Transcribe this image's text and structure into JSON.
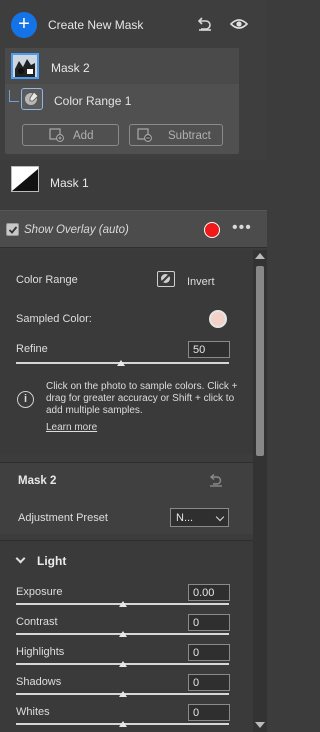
{
  "masks": {
    "create_label": "Create New Mask",
    "plus_icon": "plus-icon",
    "items": [
      {
        "label": "Mask 2",
        "selected": true
      },
      {
        "label": "Color Range 1",
        "child_of": "Mask 2"
      },
      {
        "label": "Mask 1"
      }
    ],
    "add_label": "Add",
    "subtract_label": "Subtract",
    "show_overlay_label": "Show Overlay (auto)",
    "show_overlay_checked": true,
    "overlay_color": "#f01818"
  },
  "color_range": {
    "title": "Color Range",
    "invert_label": "Invert",
    "sampled_color_label": "Sampled Color:",
    "sampled_color": "#f2d2c8",
    "refine_label": "Refine",
    "refine_value": "50",
    "refine_fraction": 0.5,
    "info_text": "Click on the photo to sample colors. Click + drag for greater accuracy or Shift + click to add multiple samples.",
    "learn_more": "Learn more"
  },
  "mask_panel": {
    "title": "Mask 2",
    "preset_label": "Adjustment Preset",
    "preset_value": "N..."
  },
  "light": {
    "title": "Light",
    "sliders": [
      {
        "label": "Exposure",
        "value": "0.00",
        "fraction": 0.5
      },
      {
        "label": "Contrast",
        "value": "0",
        "fraction": 0.5
      },
      {
        "label": "Highlights",
        "value": "0",
        "fraction": 0.5
      },
      {
        "label": "Shadows",
        "value": "0",
        "fraction": 0.5
      },
      {
        "label": "Whites",
        "value": "0",
        "fraction": 0.5
      }
    ]
  },
  "colors": {
    "accent": "#1473e6",
    "panel": "#3c3c3c",
    "selection": "#4a9cf0"
  }
}
